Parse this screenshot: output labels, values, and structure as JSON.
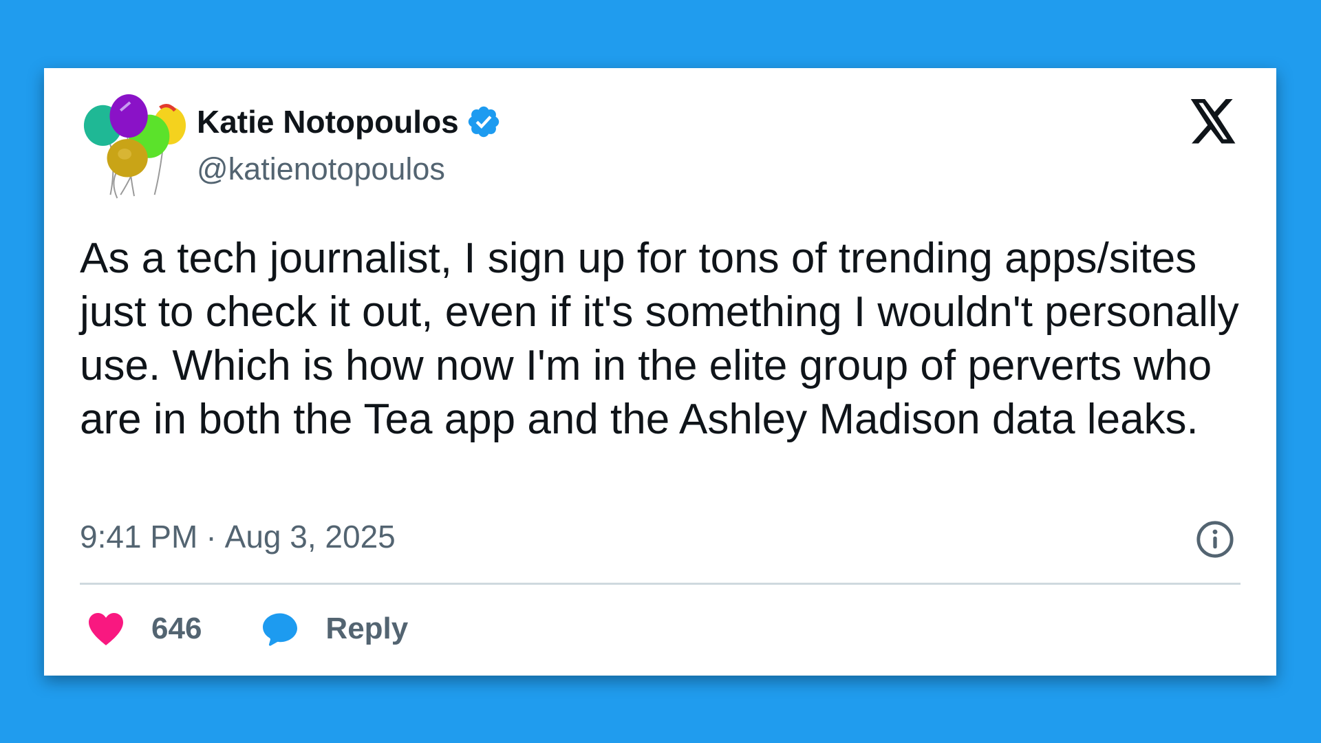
{
  "author": {
    "display_name": "Katie Notopoulos",
    "handle": "@katienotopoulos",
    "verified": true,
    "avatar_icon": "balloons-avatar"
  },
  "platform_icon": "x-logo-icon",
  "tweet": {
    "text": "As a tech journalist, I sign up for tons of trending apps/sites just to check it out, even if it's something I wouldn't personally use. Which is how now I'm in the elite group of perverts who are in both the Tea app and the Ashley Madison data leaks.",
    "time": "9:41 PM",
    "separator": "·",
    "date": "Aug 3, 2025"
  },
  "actions": {
    "like_count": "646",
    "reply_label": "Reply"
  },
  "colors": {
    "background": "#209cee",
    "card": "#ffffff",
    "text_primary": "#0f1419",
    "text_secondary": "#536471",
    "verified_badge": "#1d9bf0",
    "like_heart": "#f91880",
    "reply_bubble": "#1d9bf0",
    "divider": "#cfd9de"
  }
}
